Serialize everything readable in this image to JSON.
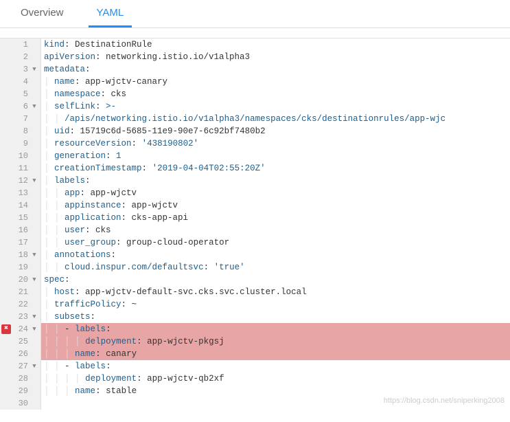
{
  "tabs": {
    "overview": "Overview",
    "yaml": "YAML"
  },
  "watermark": "https://blog.csdn.net/sniperking2008",
  "code": {
    "lines": [
      {
        "n": 1,
        "fold": false,
        "err": false,
        "hl": false,
        "c": [
          {
            "t": "kind",
            "c": "k"
          },
          {
            "t": ": DestinationRule",
            "c": "v"
          }
        ]
      },
      {
        "n": 2,
        "fold": false,
        "err": false,
        "hl": false,
        "c": [
          {
            "t": "apiVersion",
            "c": "k"
          },
          {
            "t": ": networking.istio.io/v1alpha3",
            "c": "v"
          }
        ]
      },
      {
        "n": 3,
        "fold": true,
        "err": false,
        "hl": false,
        "c": [
          {
            "t": "metadata",
            "c": "k"
          },
          {
            "t": ":",
            "c": "v"
          }
        ]
      },
      {
        "n": 4,
        "fold": false,
        "err": false,
        "hl": false,
        "c": [
          {
            "t": "  ",
            "c": "ig"
          },
          {
            "t": "name",
            "c": "k"
          },
          {
            "t": ": app-wjctv-canary",
            "c": "v"
          }
        ]
      },
      {
        "n": 5,
        "fold": false,
        "err": false,
        "hl": false,
        "c": [
          {
            "t": "  ",
            "c": "ig"
          },
          {
            "t": "namespace",
            "c": "k"
          },
          {
            "t": ": cks",
            "c": "v"
          }
        ]
      },
      {
        "n": 6,
        "fold": true,
        "err": false,
        "hl": false,
        "c": [
          {
            "t": "  ",
            "c": "ig"
          },
          {
            "t": "selfLink",
            "c": "k"
          },
          {
            "t": ": ",
            "c": "v"
          },
          {
            "t": ">-",
            "c": "s"
          }
        ]
      },
      {
        "n": 7,
        "fold": false,
        "err": false,
        "hl": false,
        "c": [
          {
            "t": "    ",
            "c": "ig"
          },
          {
            "t": "/apis/networking.istio.io/v1alpha3/namespaces/cks/destinationrules/app-wjc",
            "c": "s"
          }
        ]
      },
      {
        "n": 8,
        "fold": false,
        "err": false,
        "hl": false,
        "c": [
          {
            "t": "  ",
            "c": "ig"
          },
          {
            "t": "uid",
            "c": "k"
          },
          {
            "t": ": 15719c6d-5685-11e9-90e7-6c92bf7480b2",
            "c": "v"
          }
        ]
      },
      {
        "n": 9,
        "fold": false,
        "err": false,
        "hl": false,
        "c": [
          {
            "t": "  ",
            "c": "ig"
          },
          {
            "t": "resourceVersion",
            "c": "k"
          },
          {
            "t": ": ",
            "c": "v"
          },
          {
            "t": "'438190802'",
            "c": "s"
          }
        ]
      },
      {
        "n": 10,
        "fold": false,
        "err": false,
        "hl": false,
        "c": [
          {
            "t": "  ",
            "c": "ig"
          },
          {
            "t": "generation",
            "c": "k"
          },
          {
            "t": ": ",
            "c": "v"
          },
          {
            "t": "1",
            "c": "s"
          }
        ]
      },
      {
        "n": 11,
        "fold": false,
        "err": false,
        "hl": false,
        "c": [
          {
            "t": "  ",
            "c": "ig"
          },
          {
            "t": "creationTimestamp",
            "c": "k"
          },
          {
            "t": ": ",
            "c": "v"
          },
          {
            "t": "'2019-04-04T02:55:20Z'",
            "c": "s"
          }
        ]
      },
      {
        "n": 12,
        "fold": true,
        "err": false,
        "hl": false,
        "c": [
          {
            "t": "  ",
            "c": "ig"
          },
          {
            "t": "labels",
            "c": "k"
          },
          {
            "t": ":",
            "c": "v"
          }
        ]
      },
      {
        "n": 13,
        "fold": false,
        "err": false,
        "hl": false,
        "c": [
          {
            "t": "    ",
            "c": "ig"
          },
          {
            "t": "app",
            "c": "k"
          },
          {
            "t": ": app-wjctv",
            "c": "v"
          }
        ]
      },
      {
        "n": 14,
        "fold": false,
        "err": false,
        "hl": false,
        "c": [
          {
            "t": "    ",
            "c": "ig"
          },
          {
            "t": "appinstance",
            "c": "k"
          },
          {
            "t": ": app-wjctv",
            "c": "v"
          }
        ]
      },
      {
        "n": 15,
        "fold": false,
        "err": false,
        "hl": false,
        "c": [
          {
            "t": "    ",
            "c": "ig"
          },
          {
            "t": "application",
            "c": "k"
          },
          {
            "t": ": cks-app-api",
            "c": "v"
          }
        ]
      },
      {
        "n": 16,
        "fold": false,
        "err": false,
        "hl": false,
        "c": [
          {
            "t": "    ",
            "c": "ig"
          },
          {
            "t": "user",
            "c": "k"
          },
          {
            "t": ": cks",
            "c": "v"
          }
        ]
      },
      {
        "n": 17,
        "fold": false,
        "err": false,
        "hl": false,
        "c": [
          {
            "t": "    ",
            "c": "ig"
          },
          {
            "t": "user_group",
            "c": "k"
          },
          {
            "t": ": group-cloud-operator",
            "c": "v"
          }
        ]
      },
      {
        "n": 18,
        "fold": true,
        "err": false,
        "hl": false,
        "c": [
          {
            "t": "  ",
            "c": "ig"
          },
          {
            "t": "annotations",
            "c": "k"
          },
          {
            "t": ":",
            "c": "v"
          }
        ]
      },
      {
        "n": 19,
        "fold": false,
        "err": false,
        "hl": false,
        "c": [
          {
            "t": "    ",
            "c": "ig"
          },
          {
            "t": "cloud.inspur.com/defaultsvc",
            "c": "k"
          },
          {
            "t": ": ",
            "c": "v"
          },
          {
            "t": "'true'",
            "c": "s"
          }
        ]
      },
      {
        "n": 20,
        "fold": true,
        "err": false,
        "hl": false,
        "c": [
          {
            "t": "spec",
            "c": "k"
          },
          {
            "t": ":",
            "c": "v"
          }
        ]
      },
      {
        "n": 21,
        "fold": false,
        "err": false,
        "hl": false,
        "c": [
          {
            "t": "  ",
            "c": "ig"
          },
          {
            "t": "host",
            "c": "k"
          },
          {
            "t": ": app-wjctv-default-svc.cks.svc.cluster.local",
            "c": "v"
          }
        ]
      },
      {
        "n": 22,
        "fold": false,
        "err": false,
        "hl": false,
        "c": [
          {
            "t": "  ",
            "c": "ig"
          },
          {
            "t": "trafficPolicy",
            "c": "k"
          },
          {
            "t": ": ~",
            "c": "v"
          }
        ]
      },
      {
        "n": 23,
        "fold": true,
        "err": false,
        "hl": false,
        "c": [
          {
            "t": "  ",
            "c": "ig"
          },
          {
            "t": "subsets",
            "c": "k"
          },
          {
            "t": ":",
            "c": "v"
          }
        ]
      },
      {
        "n": 24,
        "fold": true,
        "err": true,
        "hl": true,
        "c": [
          {
            "t": "    ",
            "c": "ig"
          },
          {
            "t": "- ",
            "c": "v"
          },
          {
            "t": "labels",
            "c": "k"
          },
          {
            "t": ":",
            "c": "v"
          }
        ]
      },
      {
        "n": 25,
        "fold": false,
        "err": false,
        "hl": true,
        "c": [
          {
            "t": "        ",
            "c": "ig"
          },
          {
            "t": "delpoyment",
            "c": "k"
          },
          {
            "t": ": app-wjctv-pkgsj",
            "c": "v"
          }
        ]
      },
      {
        "n": 26,
        "fold": false,
        "err": false,
        "hl": true,
        "c": [
          {
            "t": "      ",
            "c": "ig"
          },
          {
            "t": "name",
            "c": "k"
          },
          {
            "t": ": canary",
            "c": "v"
          }
        ]
      },
      {
        "n": 27,
        "fold": true,
        "err": false,
        "hl": false,
        "c": [
          {
            "t": "    ",
            "c": "ig"
          },
          {
            "t": "- ",
            "c": "v"
          },
          {
            "t": "labels",
            "c": "k"
          },
          {
            "t": ":",
            "c": "v"
          }
        ]
      },
      {
        "n": 28,
        "fold": false,
        "err": false,
        "hl": false,
        "c": [
          {
            "t": "        ",
            "c": "ig"
          },
          {
            "t": "deployment",
            "c": "k"
          },
          {
            "t": ": app-wjctv-qb2xf",
            "c": "v"
          }
        ]
      },
      {
        "n": 29,
        "fold": false,
        "err": false,
        "hl": false,
        "c": [
          {
            "t": "      ",
            "c": "ig"
          },
          {
            "t": "name",
            "c": "k"
          },
          {
            "t": ": stable",
            "c": "v"
          }
        ]
      },
      {
        "n": 30,
        "fold": false,
        "err": false,
        "hl": false,
        "c": []
      }
    ]
  }
}
